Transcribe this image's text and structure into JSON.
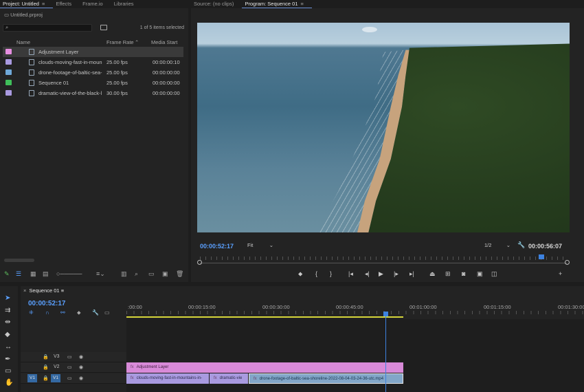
{
  "project_panel": {
    "tabs": [
      "Project: Untitled",
      "Effects",
      "Frame.io",
      "Libraries"
    ],
    "file_name": "Untitled.prproj",
    "search_placeholder": "",
    "selection_info": "1 of 5 items selected",
    "columns": {
      "name": "Name",
      "frame_rate": "Frame Rate",
      "media_start": "Media Start"
    },
    "items": [
      {
        "name": "Adjustment Layer",
        "frame_rate": "",
        "media_start": "",
        "color": "#e68ee0",
        "selected": true
      },
      {
        "name": "clouds-moving-fast-in-moun",
        "frame_rate": "25.00 fps",
        "media_start": "00:00:00:10",
        "color": "#a99ae0",
        "selected": false
      },
      {
        "name": "drone-footage-of-baltic-sea-",
        "frame_rate": "25.00 fps",
        "media_start": "00:00:00:00",
        "color": "#6fa8d8",
        "selected": false
      },
      {
        "name": "Sequence 01",
        "frame_rate": "25.00 fps",
        "media_start": "00:00:00:00",
        "color": "#3fbf5a",
        "selected": false
      },
      {
        "name": "dramatic-view-of-the-black-l",
        "frame_rate": "30.00 fps",
        "media_start": "00:00:00:00",
        "color": "#a99ae0",
        "selected": false
      }
    ]
  },
  "monitor": {
    "tabs": [
      "Source: (no clips)",
      "Program: Sequence 01"
    ],
    "current_timecode": "00:00:52:17",
    "fit_label": "Fit",
    "resolution": "1/2",
    "duration_timecode": "00:00:56:07",
    "playhead_fraction": 0.93
  },
  "timeline": {
    "sequence_name": "Sequence 01",
    "timecode": "00:00:52:17",
    "ruler_labels": [
      ":00:00",
      "00:00:15:00",
      "00:00:30:00",
      "00:00:45:00",
      "00:01:00:00",
      "00:01:15:00",
      "00:01:30:00"
    ],
    "tracks": [
      {
        "name": "V3"
      },
      {
        "name": "V2"
      },
      {
        "name": "V1",
        "target": "V1"
      }
    ],
    "clips": {
      "adjustment": "Adjustment Layer",
      "v1": [
        "clouds-moving-fast-in-mountains-in-",
        "dramatic-vie",
        "drone-footage-of-baltic-sea-shoreline-2022-08-04-03-24-36-utc.mp4"
      ]
    }
  }
}
